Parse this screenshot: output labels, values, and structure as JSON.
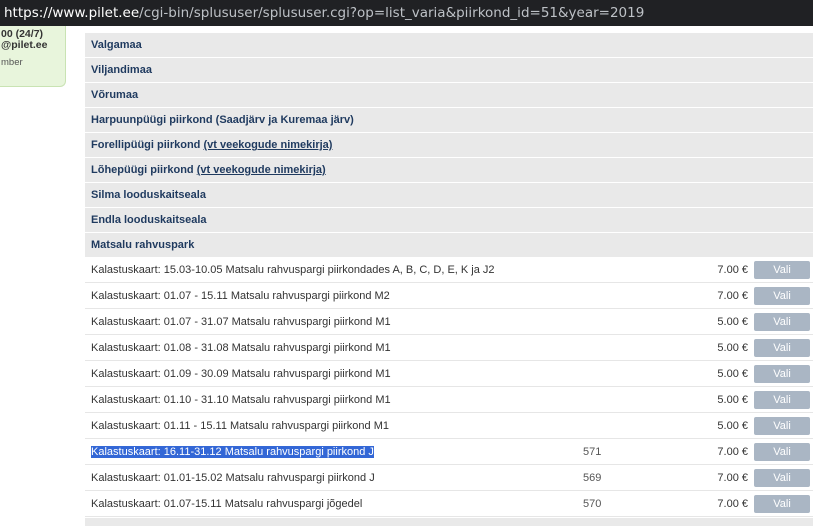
{
  "browser": {
    "url_host": "https://www.pilet.ee",
    "url_path": "/cgi-bin/splususer/splususer.cgi?op=list_varia&piirkond_id=51&year=2019"
  },
  "infobox": {
    "line1": "00 (24/7)",
    "line2": "@pilet.ee",
    "line3": "mber"
  },
  "categories": [
    {
      "label": "Valgamaa"
    },
    {
      "label": "Viljandimaa"
    },
    {
      "label": "Võrumaa"
    },
    {
      "label": "Harpuunpüügi piirkond (Saadjärv ja Kuremaa järv)"
    },
    {
      "label": "Forellipüügi piirkond ",
      "link": "(vt veekogude nimekirja)"
    },
    {
      "label": "Lõhepüügi piirkond ",
      "link": "(vt veekogude nimekirja)"
    },
    {
      "label": "Silma looduskaitseala"
    },
    {
      "label": "Endla looduskaitseala"
    },
    {
      "label": "Matsalu rahvuspark"
    }
  ],
  "items": [
    {
      "name": "Kalastuskaart: 15.03-10.05 Matsalu rahvuspargi piirkondades A, B, C, D, E, K ja J2",
      "code": "",
      "price": "7.00 €",
      "button": "Vali"
    },
    {
      "name": "Kalastuskaart: 01.07 - 15.11 Matsalu rahvuspargi piirkond M2",
      "code": "",
      "price": "7.00 €",
      "button": "Vali"
    },
    {
      "name": "Kalastuskaart: 01.07 - 31.07 Matsalu rahvuspargi piirkond M1",
      "code": "",
      "price": "5.00 €",
      "button": "Vali"
    },
    {
      "name": "Kalastuskaart: 01.08 - 31.08 Matsalu rahvuspargi piirkond M1",
      "code": "",
      "price": "5.00 €",
      "button": "Vali"
    },
    {
      "name": "Kalastuskaart: 01.09 - 30.09 Matsalu rahvuspargi piirkond M1",
      "code": "",
      "price": "5.00 €",
      "button": "Vali"
    },
    {
      "name": "Kalastuskaart: 01.10 - 31.10 Matsalu rahvuspargi piirkond M1",
      "code": "",
      "price": "5.00 €",
      "button": "Vali"
    },
    {
      "name": "Kalastuskaart: 01.11 - 15.11 Matsalu rahvuspargi piirkond M1",
      "code": "",
      "price": "5.00 €",
      "button": "Vali"
    },
    {
      "name": "Kalastuskaart: 16.11-31.12 Matsalu rahvuspargi piirkond J",
      "code": "571",
      "price": "7.00 €",
      "button": "Vali",
      "selected": true
    },
    {
      "name": "Kalastuskaart: 01.01-15.02 Matsalu rahvuspargi piirkond J",
      "code": "569",
      "price": "7.00 €",
      "button": "Vali"
    },
    {
      "name": "Kalastuskaart: 01.07-15.11 Matsalu rahvuspargi jõgedel",
      "code": "570",
      "price": "7.00 €",
      "button": "Vali"
    }
  ]
}
